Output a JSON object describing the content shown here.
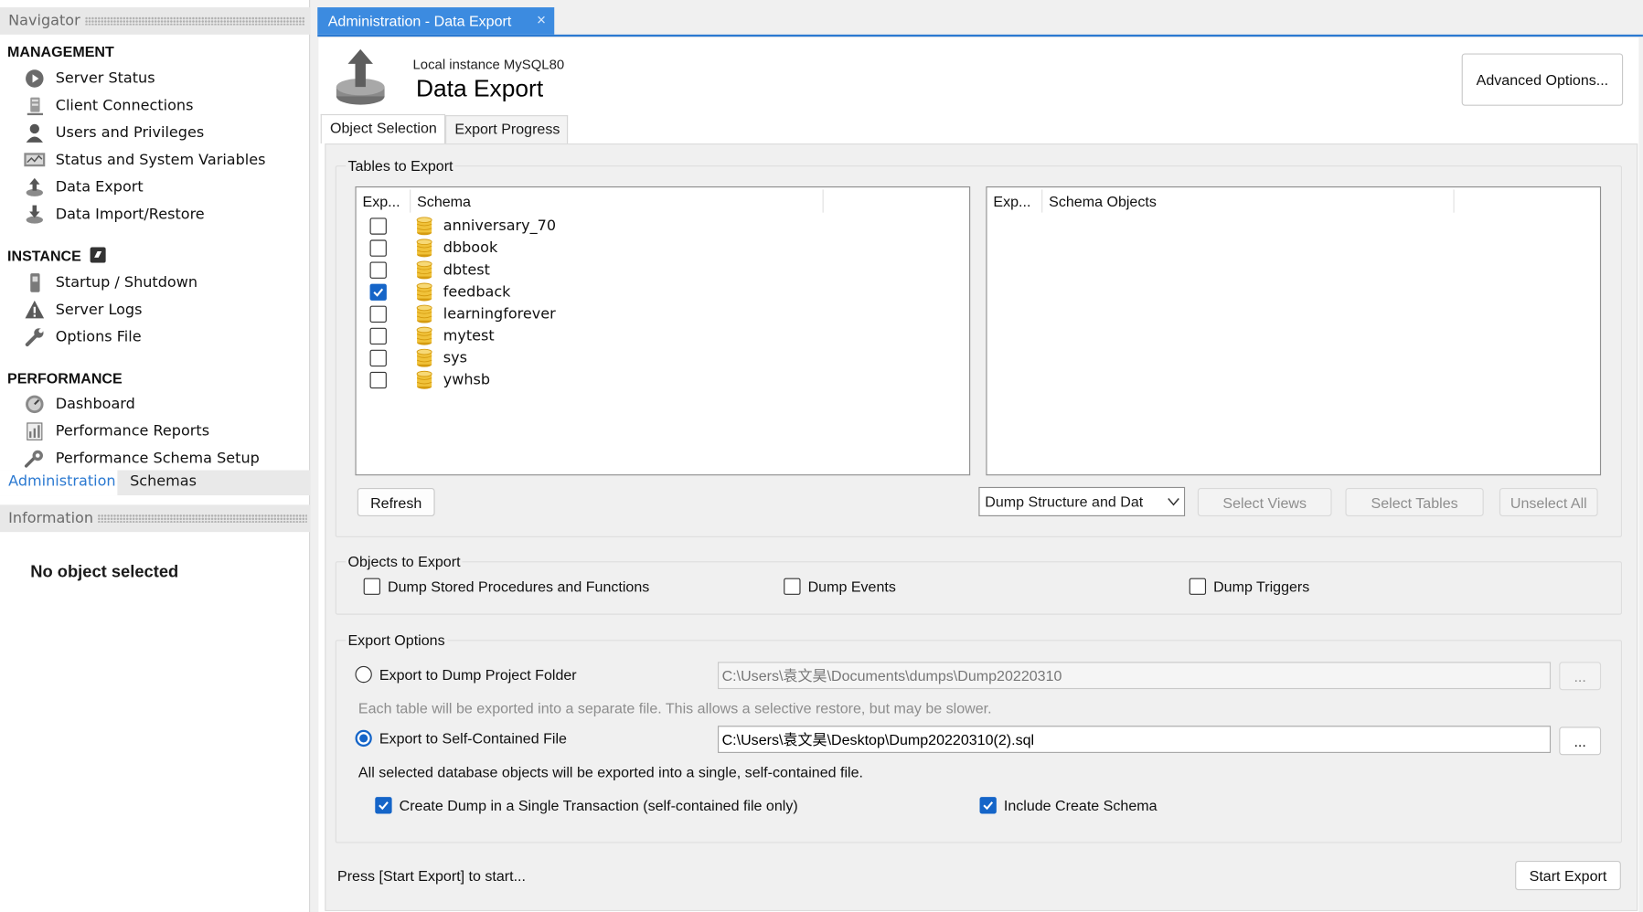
{
  "sidebar": {
    "navigator_title": "Navigator",
    "management_title": "MANAGEMENT",
    "management_items": [
      {
        "label": "Server Status",
        "icon": "server-status-icon"
      },
      {
        "label": "Client Connections",
        "icon": "client-connections-icon"
      },
      {
        "label": "Users and Privileges",
        "icon": "users-icon"
      },
      {
        "label": "Status and System Variables",
        "icon": "system-variables-icon"
      },
      {
        "label": "Data Export",
        "icon": "data-export-icon"
      },
      {
        "label": "Data Import/Restore",
        "icon": "data-import-icon"
      }
    ],
    "instance_title": "INSTANCE",
    "instance_items": [
      {
        "label": "Startup / Shutdown",
        "icon": "startup-icon"
      },
      {
        "label": "Server Logs",
        "icon": "warning-icon"
      },
      {
        "label": "Options File",
        "icon": "wrench-icon"
      }
    ],
    "performance_title": "PERFORMANCE",
    "performance_items": [
      {
        "label": "Dashboard",
        "icon": "dashboard-icon"
      },
      {
        "label": "Performance Reports",
        "icon": "reports-icon"
      },
      {
        "label": "Performance Schema Setup",
        "icon": "schema-setup-icon"
      }
    ],
    "tabs": {
      "administration": "Administration",
      "schemas": "Schemas"
    },
    "information_title": "Information",
    "no_object": "No object selected"
  },
  "doc_tab": {
    "label": "Administration - Data Export",
    "close": "×"
  },
  "header": {
    "subtitle": "Local instance MySQL80",
    "title": "Data Export",
    "advanced_button": "Advanced Options..."
  },
  "sub_tabs": {
    "object_selection": "Object Selection",
    "export_progress": "Export Progress"
  },
  "tables_group": {
    "title": "Tables to Export",
    "left_columns": {
      "exp": "Exp...",
      "schema": "Schema"
    },
    "right_columns": {
      "exp": "Exp...",
      "objects": "Schema Objects"
    },
    "schemas": [
      {
        "name": "anniversary_70",
        "checked": false
      },
      {
        "name": "dbbook",
        "checked": false
      },
      {
        "name": "dbtest",
        "checked": false
      },
      {
        "name": "feedback",
        "checked": true
      },
      {
        "name": "learningforever",
        "checked": false
      },
      {
        "name": "mytest",
        "checked": false
      },
      {
        "name": "sys",
        "checked": false
      },
      {
        "name": "ywhsb",
        "checked": false
      }
    ],
    "refresh_button": "Refresh",
    "dump_mode": "Dump Structure and Dat",
    "select_views": "Select Views",
    "select_tables": "Select Tables",
    "unselect_all": "Unselect All"
  },
  "objects_group": {
    "title": "Objects to Export",
    "stored_procs": "Dump Stored Procedures and Functions",
    "events": "Dump Events",
    "triggers": "Dump Triggers"
  },
  "export_group": {
    "title": "Export Options",
    "option_folder": "Export to Dump Project Folder",
    "folder_path": "C:\\Users\\袁文昊\\Documents\\dumps\\Dump20220310",
    "folder_note": "Each table will be exported into a separate file. This allows a selective restore, but may be slower.",
    "option_file": "Export to Self-Contained File",
    "file_path": "C:\\Users\\袁文昊\\Desktop\\Dump20220310(2).sql",
    "file_note": "All selected database objects will be exported into a single, self-contained file.",
    "single_transaction": "Create Dump in a Single Transaction (self-contained file only)",
    "include_schema": "Include Create Schema",
    "browse": "..."
  },
  "footer": {
    "status": "Press [Start Export] to start...",
    "start_button": "Start Export"
  },
  "colors": {
    "accent": "#3c8be0",
    "checkbox": "#1565c8",
    "db_icon": "#e8b11c"
  }
}
